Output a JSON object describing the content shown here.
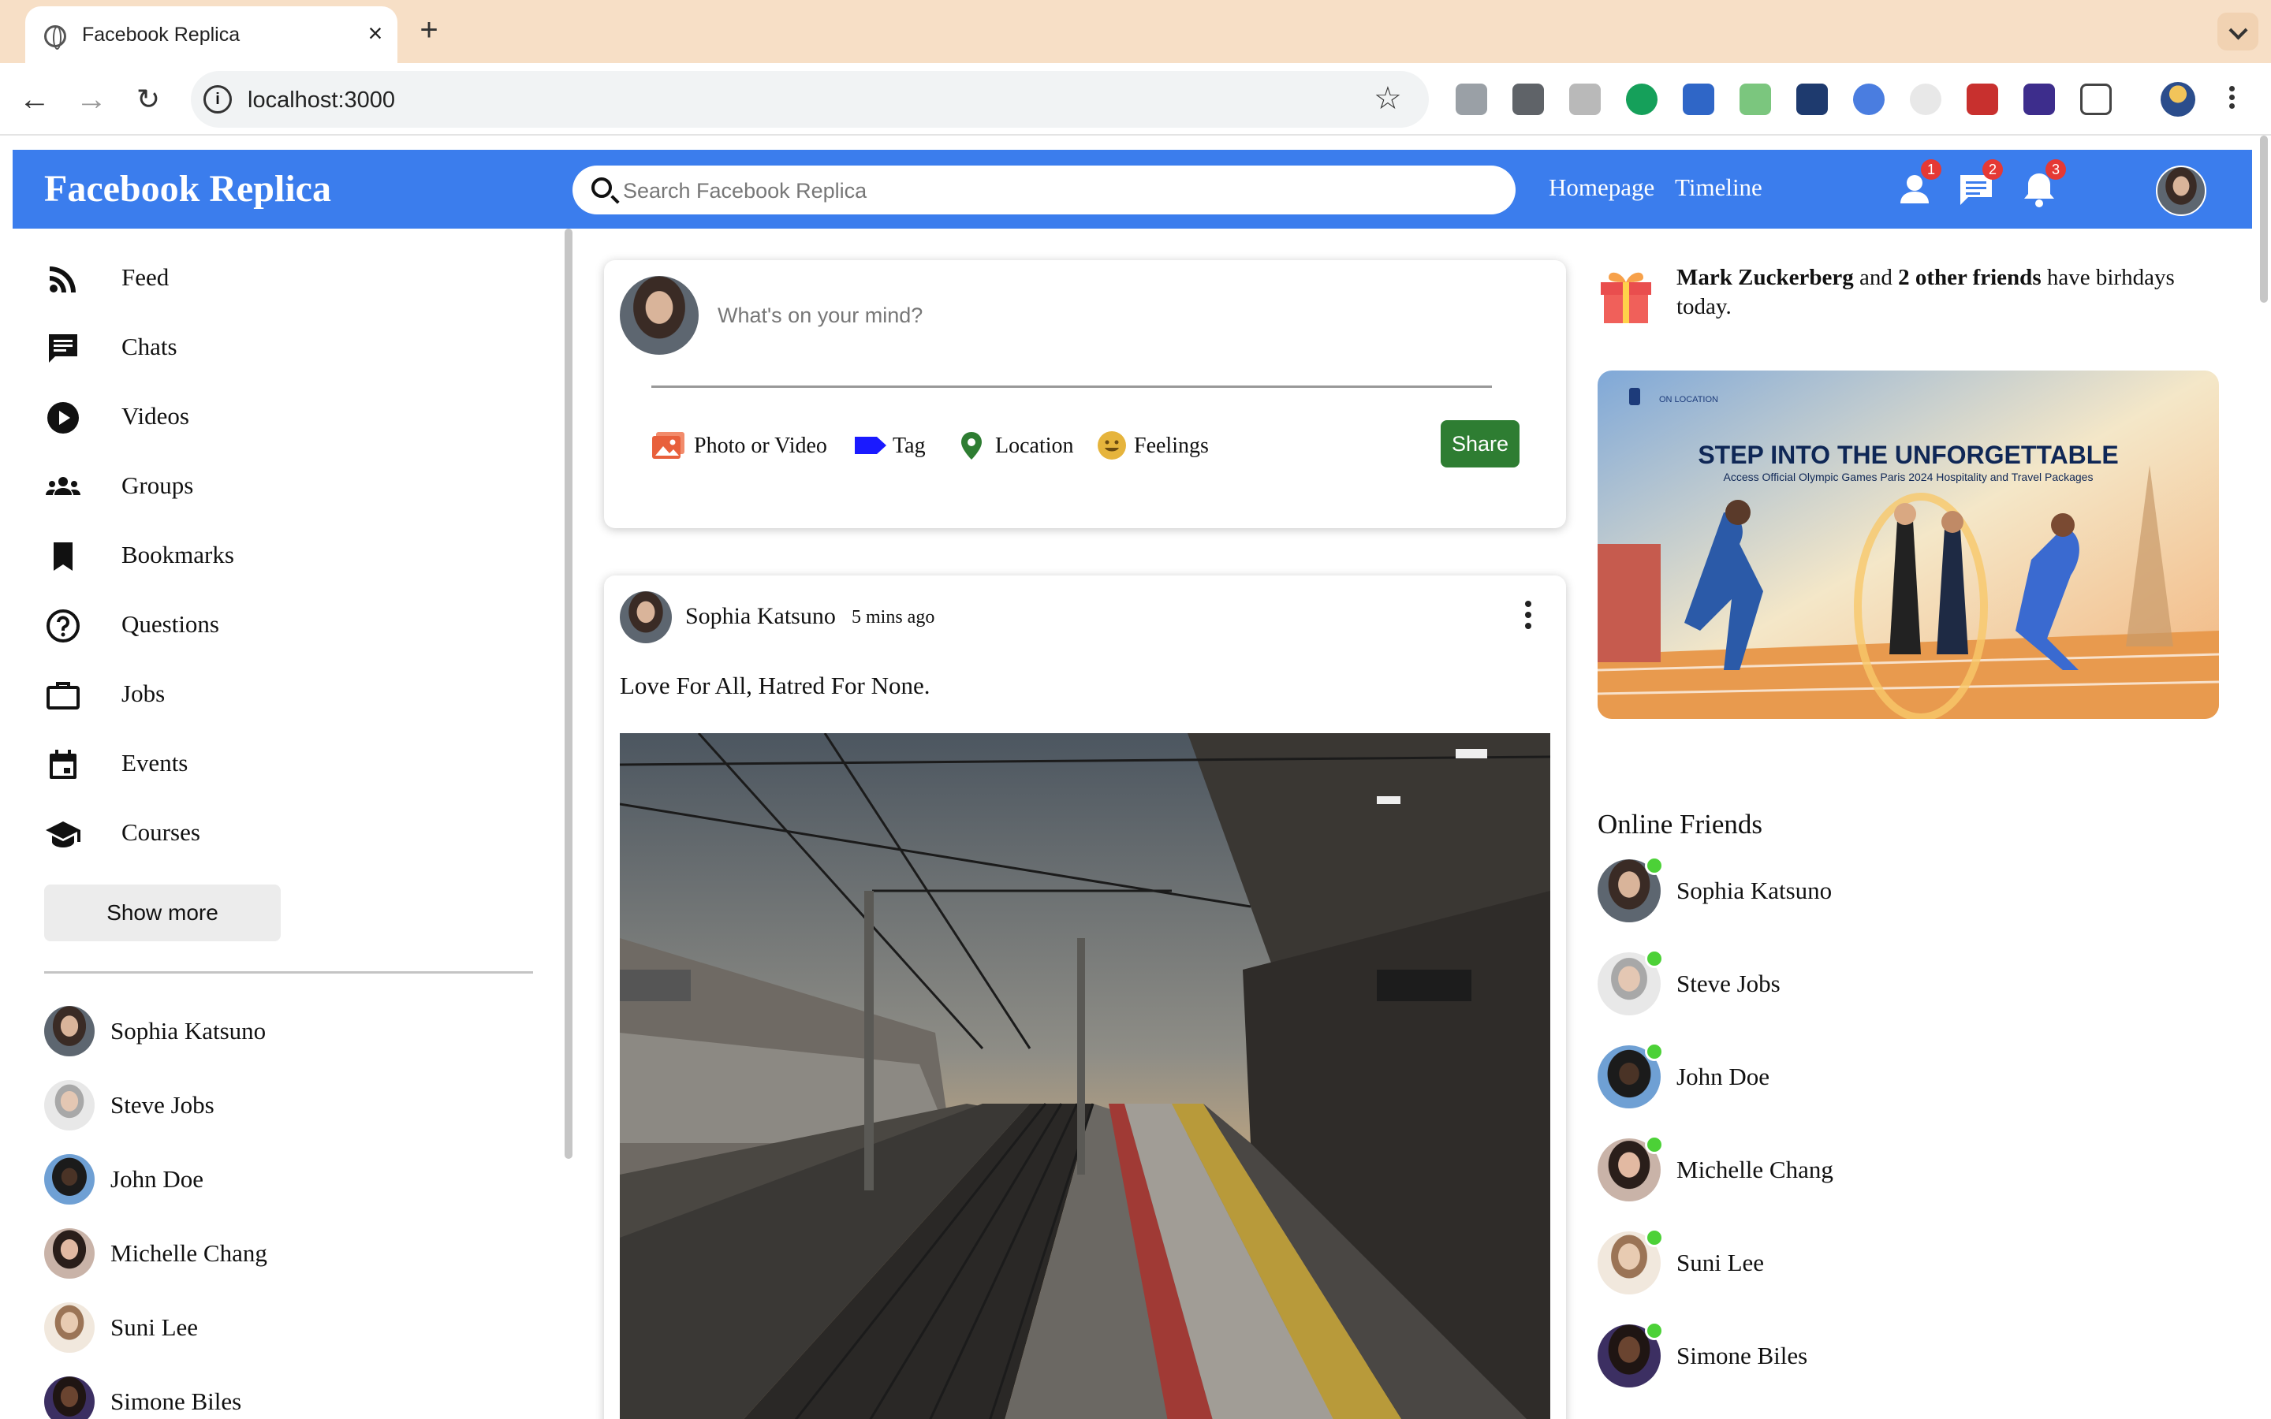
{
  "browser": {
    "tab_title": "Facebook Replica",
    "url": "localhost:3000"
  },
  "header": {
    "brand": "Facebook Replica",
    "search_placeholder": "Search Facebook Replica",
    "links": [
      "Homepage",
      "Timeline"
    ],
    "badges": {
      "friend_requests": "1",
      "messages": "2",
      "notifications": "3"
    },
    "color": "#3b7ded"
  },
  "sidebar": {
    "items": [
      {
        "label": "Feed",
        "icon": "rss-icon"
      },
      {
        "label": "Chats",
        "icon": "chat-icon"
      },
      {
        "label": "Videos",
        "icon": "play-circle-icon"
      },
      {
        "label": "Groups",
        "icon": "groups-icon"
      },
      {
        "label": "Bookmarks",
        "icon": "bookmark-icon"
      },
      {
        "label": "Questions",
        "icon": "help-circle-icon"
      },
      {
        "label": "Jobs",
        "icon": "briefcase-icon"
      },
      {
        "label": "Events",
        "icon": "calendar-icon"
      },
      {
        "label": "Courses",
        "icon": "school-icon"
      }
    ],
    "show_more": "Show more",
    "friends": [
      "Sophia Katsuno",
      "Steve Jobs",
      "John Doe",
      "Michelle Chang",
      "Suni Lee",
      "Simone Biles"
    ]
  },
  "composer": {
    "placeholder": "What's on your mind?",
    "options": [
      "Photo or Video",
      "Tag",
      "Location",
      "Feelings"
    ],
    "share": "Share"
  },
  "post": {
    "author": "Sophia Katsuno",
    "time": "5 mins ago",
    "text": "Love For All, Hatred For None."
  },
  "birthday": {
    "name": "Mark Zuckerberg",
    "middle": " and ",
    "others": "2 other friends",
    "rest": " have birhdays today."
  },
  "ad": {
    "tag": "ON LOCATION",
    "headline": "STEP INTO THE UNFORGETTABLE",
    "subline": "Access Official Olympic Games Paris 2024 Hospitality and Travel Packages"
  },
  "online": {
    "title": "Online Friends",
    "friends": [
      "Sophia Katsuno",
      "Steve Jobs",
      "John Doe",
      "Michelle Chang",
      "Suni Lee",
      "Simone Biles"
    ],
    "status_color": "#4cd137"
  }
}
